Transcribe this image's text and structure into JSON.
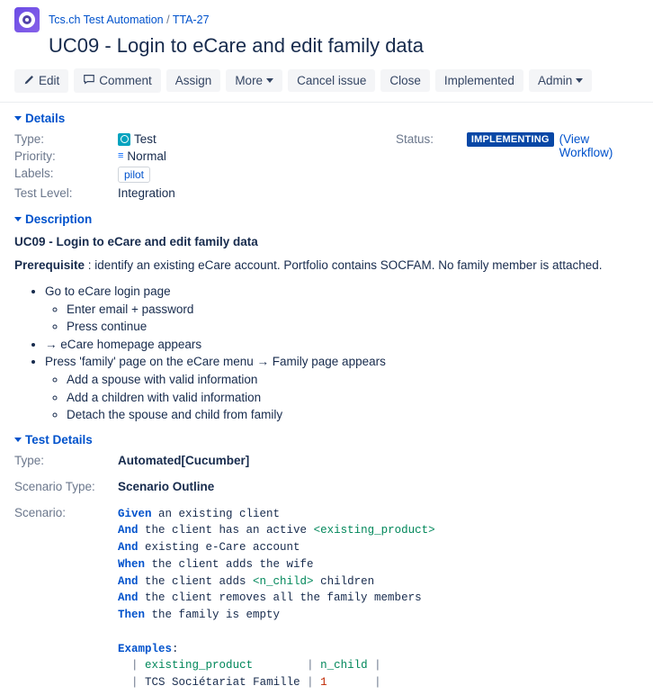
{
  "breadcrumb": {
    "project": "Tcs.ch Test Automation",
    "separator": "/",
    "key": "TTA-27"
  },
  "title": "UC09 - Login to eCare and edit family data",
  "toolbar": {
    "edit": "Edit",
    "comment": "Comment",
    "assign": "Assign",
    "more": "More",
    "cancel": "Cancel issue",
    "close": "Close",
    "implemented": "Implemented",
    "admin": "Admin"
  },
  "modules": {
    "details": "Details",
    "description": "Description",
    "testDetails": "Test Details"
  },
  "details": {
    "typeLabel": "Type:",
    "typeValue": "Test",
    "priorityLabel": "Priority:",
    "priorityValue": "Normal",
    "labelsLabel": "Labels:",
    "labelsValue": "pilot",
    "testLevelLabel": "Test Level:",
    "testLevelValue": "Integration",
    "statusLabel": "Status:",
    "statusValue": "IMPLEMENTING",
    "viewWorkflow": "(View Workflow)"
  },
  "description": {
    "heading": "UC09 - Login to eCare and edit family data",
    "prereqLabel": "Prerequisite",
    "prereqText": " : identify an existing eCare account. Portfolio contains SOCFAM. No family member is attached.",
    "bullets": {
      "b1": "Go to eCare login page",
      "b1a": "Enter email + password",
      "b1b": "Press continue",
      "b2": "→ eCare homepage appears",
      "b3": "Press 'family' page on the eCare menu → Family page appears",
      "b3a": "Add a spouse with valid information",
      "b3b": "Add a children with valid information",
      "b3c": "Detach the spouse and child from family"
    }
  },
  "testDetails": {
    "typeLabel": "Type:",
    "typeValue": "Automated[Cucumber]",
    "scenarioTypeLabel": "Scenario Type:",
    "scenarioTypeValue": "Scenario Outline",
    "scenarioLabel": "Scenario:",
    "gherkin": {
      "given": "Given",
      "and": "And",
      "when": "When",
      "then": "Then",
      "examples": "Examples",
      "l1": " an existing client",
      "l2": " the client has an active ",
      "l2p": "<existing_product>",
      "l3": " existing e-Care account",
      "l4": " the client adds the wife",
      "l5": " the client adds ",
      "l5p": "<n_child>",
      "l5b": " children",
      "l6": " the client removes all the family members",
      "l7": " the family is empty",
      "th1": "existing_product",
      "th2": "n_child",
      "td1": "TCS Sociétariat Famille",
      "td2": "1"
    }
  }
}
